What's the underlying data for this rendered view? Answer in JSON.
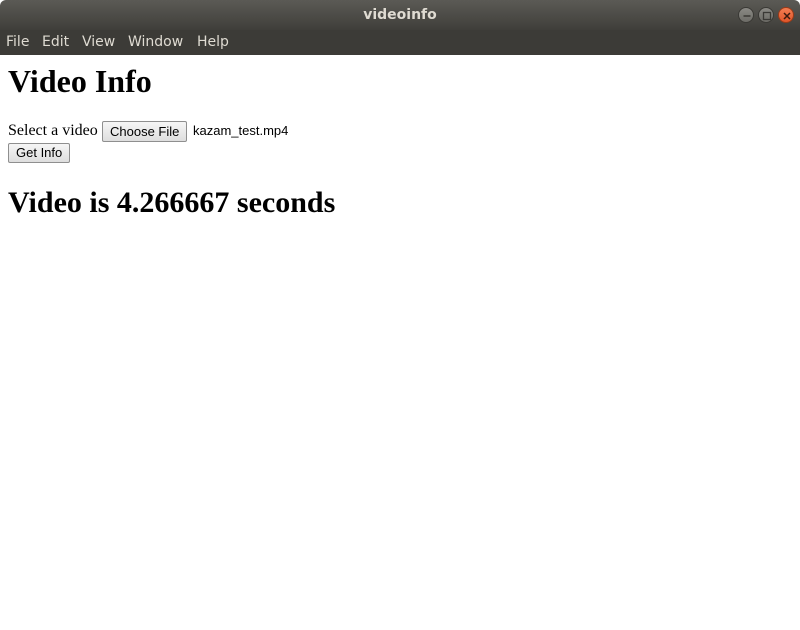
{
  "window": {
    "title": "videoinfo",
    "controls": [
      "minimize-icon",
      "maximize-icon",
      "close-icon"
    ],
    "close_color": "#e9602f"
  },
  "menubar": {
    "items": [
      {
        "label": "File"
      },
      {
        "label": "Edit"
      },
      {
        "label": "View"
      },
      {
        "label": "Window"
      },
      {
        "label": "Help"
      }
    ]
  },
  "page": {
    "heading": "Video Info",
    "select_label": "Select a video",
    "choose_file_label": "Choose File",
    "selected_file": "kazam_test.mp4",
    "get_info_label": "Get Info",
    "result": "Video is 4.266667 seconds"
  }
}
